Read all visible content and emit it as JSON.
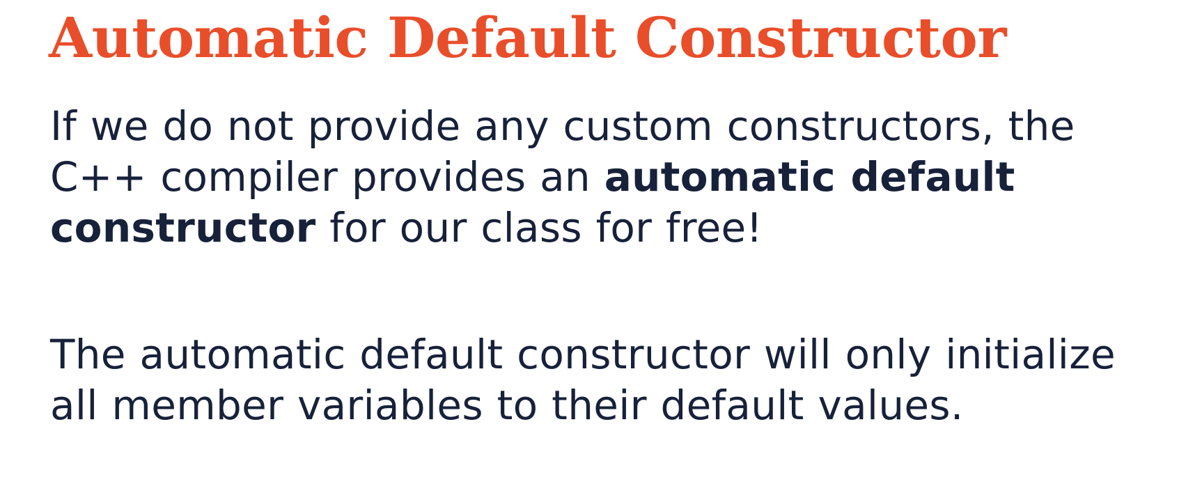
{
  "slide": {
    "title": "Automatic Default Constructor",
    "paragraph1": {
      "before": "If we do not provide any custom constructors, the C++ compiler provides an ",
      "emphasis": "automatic default constructor",
      "after": " for our class for free!"
    },
    "paragraph2": "The automatic default constructor will only initialize all member variables to their default values."
  },
  "colors": {
    "title": "#e94e2a",
    "text": "#17213a",
    "background": "#ffffff"
  }
}
